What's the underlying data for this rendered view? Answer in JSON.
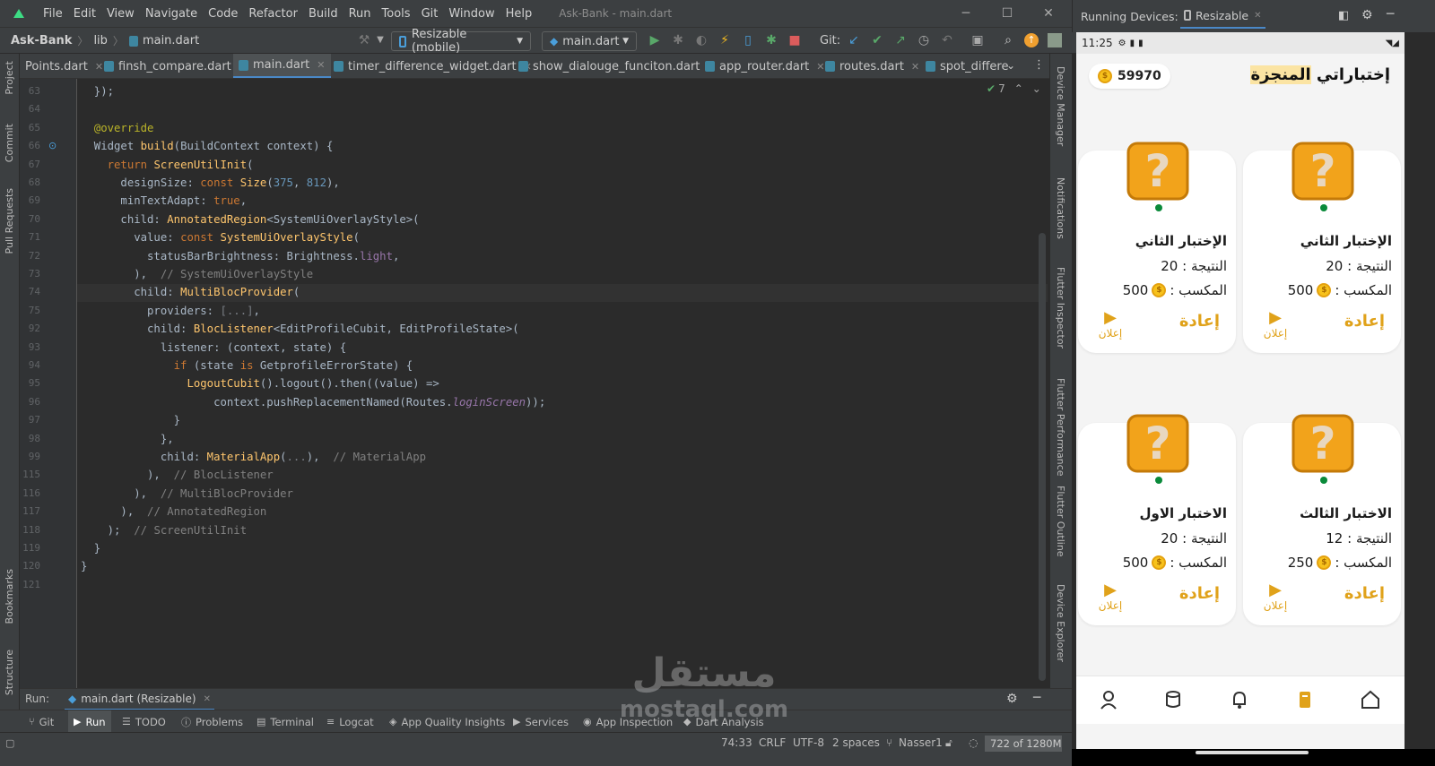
{
  "menu": {
    "items": [
      "File",
      "Edit",
      "View",
      "Navigate",
      "Code",
      "Refactor",
      "Build",
      "Run",
      "Tools",
      "Git",
      "Window",
      "Help"
    ],
    "title": "Ask-Bank - main.dart"
  },
  "nav": {
    "project": "Ask-Bank",
    "folder": "lib",
    "file": "main.dart",
    "device_combo": "Resizable (mobile)",
    "config_combo": "main.dart",
    "git_label": "Git:"
  },
  "tabs": [
    {
      "label": "Points.dart"
    },
    {
      "label": "finsh_compare.dart"
    },
    {
      "label": "main.dart"
    },
    {
      "label": "timer_difference_widget.dart"
    },
    {
      "label": "show_dialouge_funciton.dart"
    },
    {
      "label": "app_router.dart"
    },
    {
      "label": "routes.dart"
    },
    {
      "label": "spot_differe"
    }
  ],
  "left_tools": [
    "Project",
    "Commit",
    "Pull Requests",
    "Bookmarks",
    "Structure"
  ],
  "right_tools": [
    "Device Manager",
    "Notifications",
    "Flutter Inspector",
    "Flutter Performance",
    "Flutter Outline",
    "Device Explorer"
  ],
  "editor": {
    "inspection_count": "7",
    "lines": [
      {
        "n": "63",
        "code": "  });"
      },
      {
        "n": "64",
        "code": ""
      },
      {
        "n": "65",
        "code": "  @override"
      },
      {
        "n": "66",
        "code": "  Widget build(BuildContext context) {"
      },
      {
        "n": "67",
        "code": "    return ScreenUtilInit("
      },
      {
        "n": "68",
        "code": "      designSize: const Size(375, 812),"
      },
      {
        "n": "69",
        "code": "      minTextAdapt: true,"
      },
      {
        "n": "70",
        "code": "      child: AnnotatedRegion<SystemUiOverlayStyle>("
      },
      {
        "n": "71",
        "code": "        value: const SystemUiOverlayStyle("
      },
      {
        "n": "72",
        "code": "          statusBarBrightness: Brightness.light,"
      },
      {
        "n": "73",
        "code": "        ),  // SystemUiOverlayStyle"
      },
      {
        "n": "74",
        "code": "        child: MultiBlocProvider("
      },
      {
        "n": "75",
        "code": "          providers: [...],"
      },
      {
        "n": "92",
        "code": "          child: BlocListener<EditProfileCubit, EditProfileState>("
      },
      {
        "n": "93",
        "code": "            listener: (context, state) {"
      },
      {
        "n": "94",
        "code": "              if (state is GetprofileErrorState) {"
      },
      {
        "n": "95",
        "code": "                LogoutCubit().logout().then((value) =>"
      },
      {
        "n": "96",
        "code": "                    context.pushReplacementNamed(Routes.loginScreen));"
      },
      {
        "n": "97",
        "code": "              }"
      },
      {
        "n": "98",
        "code": "            },"
      },
      {
        "n": "99",
        "code": "            child: MaterialApp(...),  // MaterialApp"
      },
      {
        "n": "115",
        "code": "          ),  // BlocListener"
      },
      {
        "n": "116",
        "code": "        ),  // MultiBlocProvider"
      },
      {
        "n": "117",
        "code": "      ),  // AnnotatedRegion"
      },
      {
        "n": "118",
        "code": "    );  // ScreenUtilInit"
      },
      {
        "n": "119",
        "code": "  }"
      },
      {
        "n": "120",
        "code": "}"
      },
      {
        "n": "121",
        "code": ""
      }
    ]
  },
  "run_panel": {
    "label": "Run:",
    "tab": "main.dart (Resizable)"
  },
  "bottom_tools": [
    "Git",
    "Run",
    "TODO",
    "Problems",
    "Terminal",
    "Logcat",
    "App Quality Insights",
    "Services",
    "App Inspection",
    "Dart Analysis"
  ],
  "status": {
    "position": "74:33",
    "line_sep": "CRLF",
    "encoding": "UTF-8",
    "indent": "2 spaces",
    "branch": "Nasser1",
    "memory": "722 of 1280M"
  },
  "devices": {
    "header": "Running Devices:",
    "tab": "Resizable"
  },
  "phone": {
    "time": "11:25",
    "coins": "59970",
    "title_plain": "إختباراتي ",
    "title_highlight": "المنجزة",
    "cards": [
      {
        "title": "الإختبار الثاني",
        "result": "النتيجة : 20",
        "earn_label": "المكسب :",
        "earn": "500",
        "redo": "إعادة",
        "ad": "إعلان"
      },
      {
        "title": "الإختبار الثاني",
        "result": "النتيجة : 20",
        "earn_label": "المكسب :",
        "earn": "500",
        "redo": "إعادة",
        "ad": "إعلان"
      },
      {
        "title": "الاختبار الثالث",
        "result": "النتيجة : 12",
        "earn_label": "المكسب :",
        "earn": "250",
        "redo": "إعادة",
        "ad": "إعلان"
      },
      {
        "title": "الاختبار الاول",
        "result": "النتيجة : 20",
        "earn_label": "المكسب :",
        "earn": "500",
        "redo": "إعادة",
        "ad": "إعلان"
      }
    ]
  },
  "watermark": {
    "ar": "مستقل",
    "en": "mostaql.com"
  },
  "colors": {
    "accent": "#e0a21a",
    "ide_bg": "#2b2b2b",
    "panel": "#3c3f41",
    "active_tab": "#4a88c7"
  }
}
